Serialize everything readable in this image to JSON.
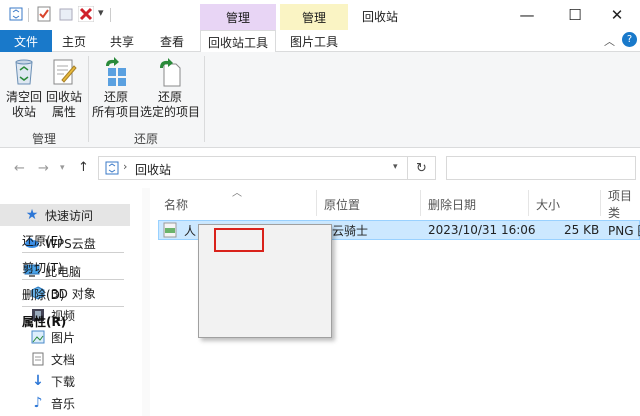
{
  "window": {
    "title": "回收站",
    "context_groups": [
      "管理",
      "管理"
    ],
    "controls": {
      "minimize": "—",
      "maximize": "☐",
      "close": "✕"
    },
    "colors": {
      "manage1": "#e8d5f5",
      "manage2": "#faf4c4",
      "file_tab": "#1979ca",
      "selection": "#cce8ff",
      "highlight_box": "#d9221b"
    }
  },
  "tabs": [
    "文件",
    "主页",
    "共享",
    "查看",
    "回收站工具",
    "图片工具"
  ],
  "ribbon": {
    "buttons": {
      "empty": [
        "清空回",
        "收站"
      ],
      "props": [
        "回收站",
        "属性"
      ],
      "restore_all": [
        "还原",
        "所有项目"
      ],
      "restore_sel": [
        "还原",
        "选定的项目"
      ]
    },
    "groups": [
      "管理",
      "还原"
    ]
  },
  "address": {
    "path": "回收站"
  },
  "nav": [
    "快速访问",
    "WPS云盘",
    "此电脑",
    "3D 对象",
    "视频",
    "图片",
    "文档",
    "下载",
    "音乐"
  ],
  "columns": [
    "名称",
    "原位置",
    "删除日期",
    "大小",
    "项目类"
  ],
  "file": {
    "name": "人",
    "origin": "\\云骑士",
    "date": "2023/10/31 16:06",
    "size": "25 KB",
    "type": "PNG 图"
  },
  "menu": [
    "还原(E)",
    "剪切(T)",
    "删除(D)",
    "属性(R)"
  ]
}
